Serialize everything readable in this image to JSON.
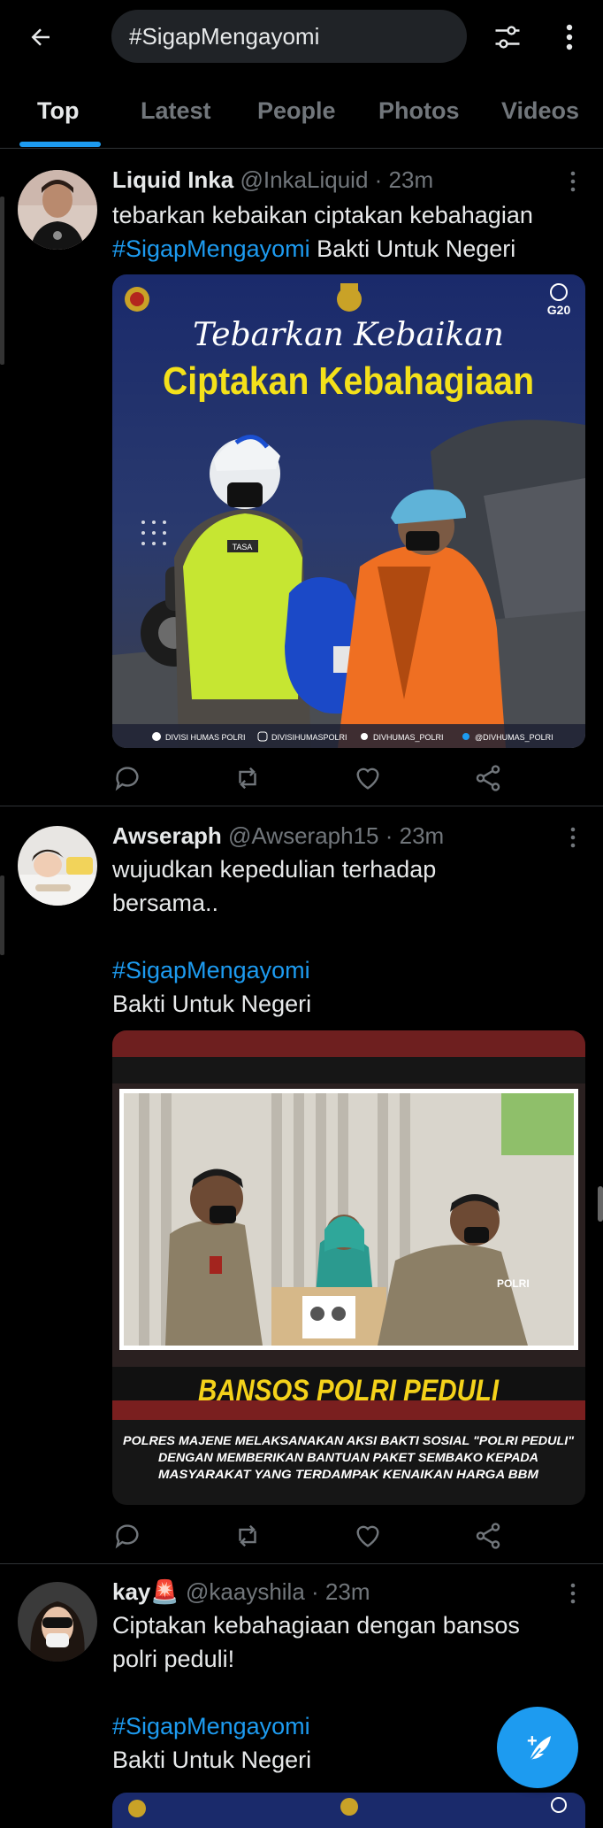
{
  "header": {
    "search_value": "#SigapMengayomi",
    "back_icon": "arrow-left-icon",
    "filter_icon": "sliders-icon",
    "more_icon": "more-vertical-icon"
  },
  "tabs": [
    {
      "label": "Top",
      "active": true
    },
    {
      "label": "Latest",
      "active": false
    },
    {
      "label": "People",
      "active": false
    },
    {
      "label": "Photos",
      "active": false
    },
    {
      "label": "Videos",
      "active": false
    }
  ],
  "tweets": [
    {
      "name": "Liquid Inka",
      "handle": "@InkaLiquid",
      "time": "· 23m",
      "lines": [
        "tebarkan kebaikan ciptakan kebahagian"
      ],
      "hashtag": "#SigapMengayomi",
      "after_hashtag": " Bakti Untuk Negeri",
      "media": {
        "script_title": "Tebarkan Kebaikan",
        "title": "Ciptakan Kebahagiaan",
        "badge": "G20",
        "footer": [
          "DIVISI HUMAS POLRI",
          "DIVISIHUMASPOLRI",
          "DIVHUMAS_POLRI",
          "@DIVHUMAS_POLRI"
        ],
        "vest_label": "TASA"
      }
    },
    {
      "name": "Awseraph",
      "handle": "@Awseraph15",
      "time": "· 23m",
      "lines": [
        "wujudkan kepedulian terhadap",
        "bersama.."
      ],
      "hashtag": "#SigapMengayomi",
      "after_hashtag_line": "Bakti Untuk Negeri",
      "media": {
        "title": "BANSOS POLRI PEDULI",
        "caption": [
          "POLRES MAJENE MELAKSANAKAN AKSI BAKTI SOSIAL \"POLRI PEDULI\"",
          "DENGAN MEMBERIKAN BANTUAN PAKET SEMBAKO KEPADA",
          "MASYARAKAT YANG TERDAMPAK KENAIKAN HARGA BBM"
        ],
        "badge_label": "POLRI"
      }
    },
    {
      "name": "kay",
      "name_emoji": "🚨",
      "handle": "@kaayshila",
      "time": "· 23m",
      "lines": [
        "Ciptakan kebahagiaan dengan bansos",
        "polri peduli!"
      ],
      "hashtag": "#SigapMengayomi",
      "after_hashtag_line": "Bakti Untuk Negeri"
    }
  ],
  "fab": {
    "label": "+",
    "icon": "compose-feather-icon"
  },
  "colors": {
    "accent": "#1d9bf0",
    "background": "#000000",
    "muted": "#71767b"
  }
}
